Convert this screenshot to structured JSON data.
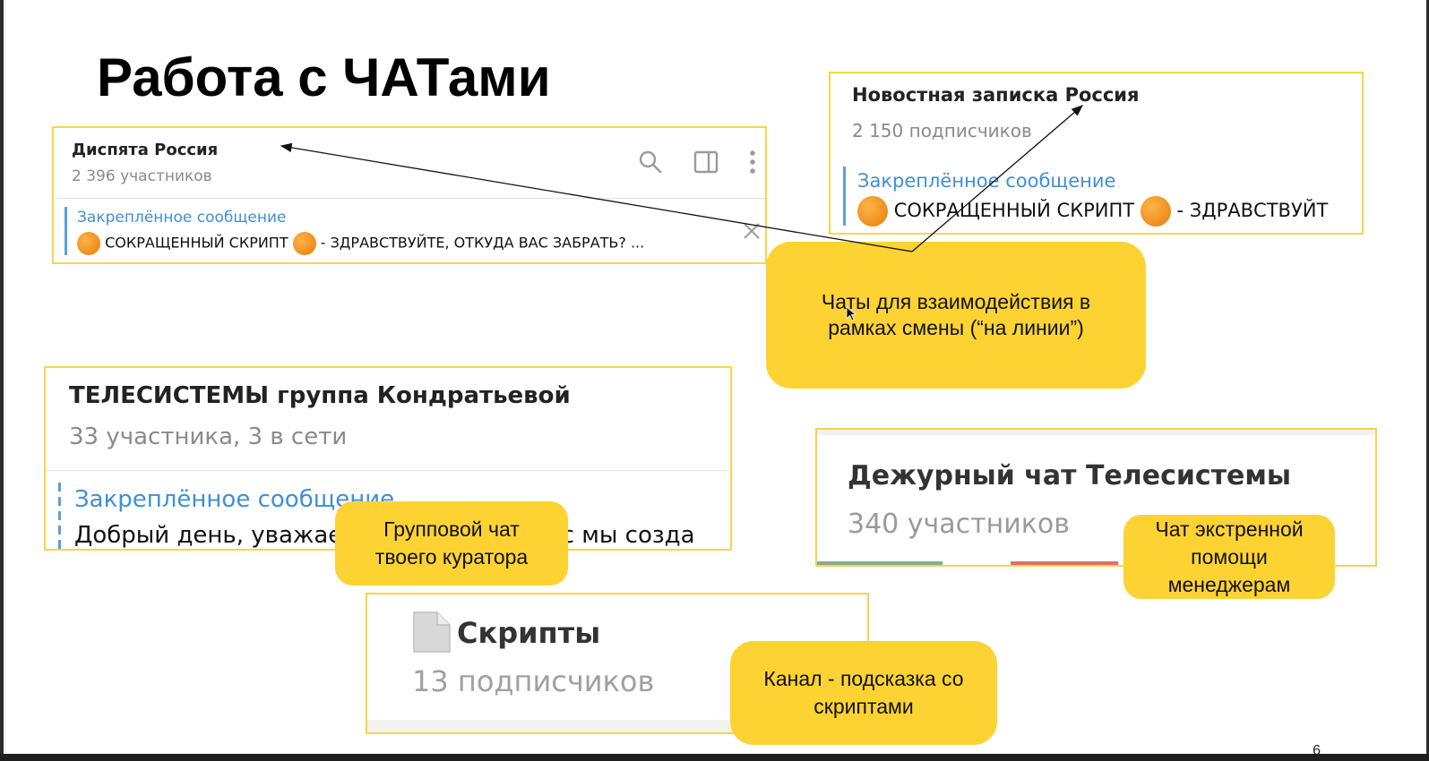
{
  "slide": {
    "title": "Работа с ЧАТами",
    "page_number": "6"
  },
  "panels": {
    "dispatch": {
      "title": "Диспята Россия",
      "subtitle": "2 396 участников",
      "pinned_label": "Закреплённое сообщение",
      "pinned_text_1": "СОКРАЩЕННЫЙ СКРИПТ",
      "pinned_text_2": "- ЗДРАВСТВУЙТЕ, ОТКУДА ВАС ЗАБРАТЬ? ...",
      "icons": [
        "search-icon",
        "sidebar-toggle-icon",
        "more-vertical-icon",
        "close-icon"
      ]
    },
    "news": {
      "title": "Новостная записка Россия",
      "subtitle": "2 150 подписчиков",
      "pinned_label": "Закреплённое сообщение",
      "pinned_text_1": "СОКРАЩЕННЫЙ СКРИПТ",
      "pinned_text_2": "- ЗДРАВСТВУЙТ"
    },
    "curator": {
      "title": "ТЕЛЕСИСТЕМЫ группа Кондратьевой",
      "subtitle": "33 участника, 3 в сети",
      "pinned_label": "Закреплённое сообщение",
      "pinned_text": "Добрый день, уважаемые                   вас мы созда"
    },
    "duty": {
      "title": "Дежурный чат Телесистемы",
      "subtitle": "340 участников"
    },
    "scripts": {
      "title": "Скрипты",
      "subtitle": "13 подписчиков",
      "icon": "document-icon"
    }
  },
  "callouts": {
    "shift_chats": [
      "Чаты для взаимодействия в",
      "рамках смены (“на линии”)"
    ],
    "curator_chat": [
      "Групповой чат",
      "твоего куратора"
    ],
    "emergency_chat": [
      "Чат экстренной",
      "помощи",
      "менеджерам"
    ],
    "scripts_channel": [
      "Канал - подсказка со",
      "скриптами"
    ]
  },
  "colors": {
    "callout": "#fdd333",
    "panel_border": "#f7d54a",
    "pinned_label": "#3f8fd6"
  }
}
